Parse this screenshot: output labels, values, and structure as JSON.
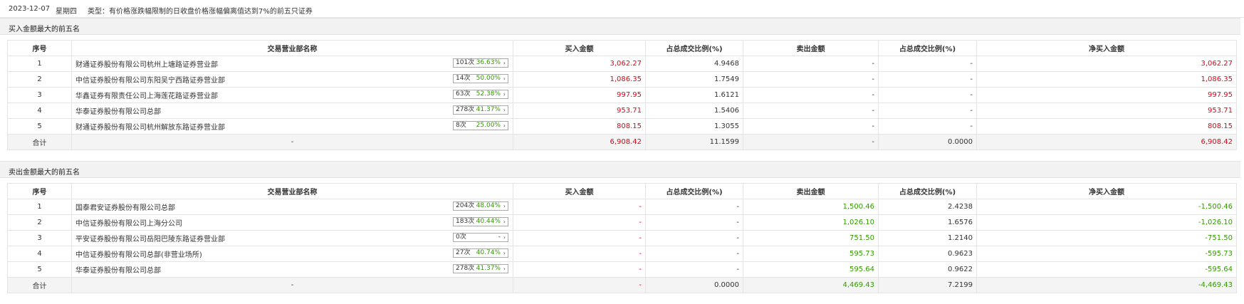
{
  "header": {
    "date": "2023-12-07",
    "weekday": "星期四",
    "type_text": "类型：有价格涨跌幅限制的日收盘价格涨幅偏离值达到7%的前五只证券"
  },
  "columns": {
    "idx": "序号",
    "name": "交易营业部名称",
    "buy": "买入金额",
    "buy_pct": "占总成交比例(%)",
    "sell": "卖出金额",
    "sell_pct": "占总成交比例(%)",
    "net": "净买入金额"
  },
  "colors": {
    "up": "#e60012",
    "down": "#339900"
  },
  "buy_section": {
    "title": "买入金额最大的前五名",
    "rows": [
      {
        "idx": "1",
        "name": "财通证券股份有限公司杭州上塘路证券营业部",
        "count": "101次",
        "pct": "36.63%",
        "arrow": "›",
        "buy": "3,062.27",
        "buy_pct": "4.9468",
        "sell": "-",
        "sell_pct": "-",
        "net": "3,062.27"
      },
      {
        "idx": "2",
        "name": "中信证券股份有限公司东阳吴宁西路证券营业部",
        "count": "14次",
        "pct": "50.00%",
        "arrow": "›",
        "buy": "1,086.35",
        "buy_pct": "1.7549",
        "sell": "-",
        "sell_pct": "-",
        "net": "1,086.35"
      },
      {
        "idx": "3",
        "name": "华鑫证券有限责任公司上海莲花路证券营业部",
        "count": "63次",
        "pct": "52.38%",
        "arrow": "›",
        "buy": "997.95",
        "buy_pct": "1.6121",
        "sell": "-",
        "sell_pct": "-",
        "net": "997.95"
      },
      {
        "idx": "4",
        "name": "华泰证券股份有限公司总部",
        "count": "278次",
        "pct": "41.37%",
        "arrow": "›",
        "buy": "953.71",
        "buy_pct": "1.5406",
        "sell": "-",
        "sell_pct": "-",
        "net": "953.71"
      },
      {
        "idx": "5",
        "name": "财通证券股份有限公司杭州解放东路证券营业部",
        "count": "8次",
        "pct": "25.00%",
        "arrow": "›",
        "buy": "808.15",
        "buy_pct": "1.3055",
        "sell": "-",
        "sell_pct": "-",
        "net": "808.15"
      }
    ],
    "total": {
      "label": "合计",
      "name": "-",
      "buy": "6,908.42",
      "buy_pct": "11.1599",
      "sell": "-",
      "sell_pct": "0.0000",
      "net": "6,908.42"
    }
  },
  "sell_section": {
    "title": "卖出金额最大的前五名",
    "rows": [
      {
        "idx": "1",
        "name": "国泰君安证券股份有限公司总部",
        "count": "204次",
        "pct": "48.04%",
        "arrow": "›",
        "buy": "-",
        "buy_pct": "-",
        "sell": "1,500.46",
        "sell_pct": "2.4238",
        "net": "-1,500.46"
      },
      {
        "idx": "2",
        "name": "中信证券股份有限公司上海分公司",
        "count": "183次",
        "pct": "40.44%",
        "arrow": "›",
        "buy": "-",
        "buy_pct": "-",
        "sell": "1,026.10",
        "sell_pct": "1.6576",
        "net": "-1,026.10"
      },
      {
        "idx": "3",
        "name": "平安证券股份有限公司岳阳巴陵东路证券营业部",
        "count": "0次",
        "pct": "-",
        "arrow": "›",
        "buy": "-",
        "buy_pct": "-",
        "sell": "751.50",
        "sell_pct": "1.2140",
        "net": "-751.50"
      },
      {
        "idx": "4",
        "name": "中信证券股份有限公司总部(非营业场所)",
        "count": "27次",
        "pct": "40.74%",
        "arrow": "›",
        "buy": "-",
        "buy_pct": "-",
        "sell": "595.73",
        "sell_pct": "0.9623",
        "net": "-595.73"
      },
      {
        "idx": "5",
        "name": "华泰证券股份有限公司总部",
        "count": "278次",
        "pct": "41.37%",
        "arrow": "›",
        "buy": "-",
        "buy_pct": "-",
        "sell": "595.64",
        "sell_pct": "0.9622",
        "net": "-595.64"
      }
    ],
    "total": {
      "label": "合计",
      "name": "-",
      "buy": "-",
      "buy_pct": "0.0000",
      "sell": "4,469.43",
      "sell_pct": "7.2199",
      "net": "-4,469.43"
    }
  }
}
